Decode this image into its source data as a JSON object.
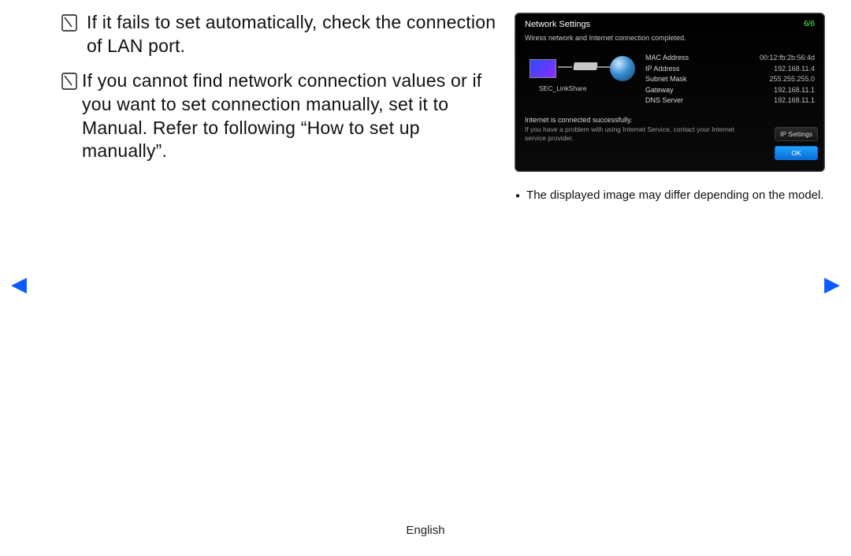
{
  "notes": {
    "item1": "If it fails to set automatically, check the connection of LAN port.",
    "item2": "If you cannot find network connection values or if you want to set connection manually, set it to Manual. Refer to following “How to set up manually”."
  },
  "panel": {
    "title": "Network Settings",
    "step": "6/6",
    "subtitle": "Wiress network and Internet connection completed.",
    "link_name": "SEC_LinkShare",
    "fields": {
      "mac_label": "MAC Address",
      "mac_value": "00:12:fb:2b:56:4d",
      "ip_label": "IP Address",
      "ip_value": "192.168.11.4",
      "subnet_label": "Subnet Mask",
      "subnet_value": "255.255.255.0",
      "gw_label": "Gateway",
      "gw_value": "192.168.11.1",
      "dns_label": "DNS Server",
      "dns_value": "192.168.11.1"
    },
    "msg1": "Internet is connected successfully.",
    "msg2": "If you have a problem with using Internet Service, contact your Internet service provider.",
    "buttons": {
      "ip_settings": "IP Settings",
      "ok": "OK"
    }
  },
  "caption": "The displayed image may differ depending on the model.",
  "footer": "English"
}
